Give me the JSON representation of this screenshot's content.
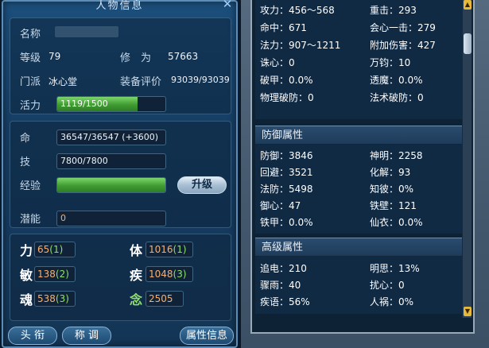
{
  "left": {
    "title": "人物信息",
    "name_label": "名称",
    "name_value": "",
    "level_label": "等级",
    "level_value": "79",
    "cultivation_label": "修　为",
    "cultivation_value": "57663",
    "faction_label": "门派",
    "faction_value": "冰心堂",
    "equip_label": "装备评价",
    "equip_value": "93039/93039",
    "vitality_label": "活力",
    "vitality_value": "1119/1500",
    "vitality_ratio": 0.746,
    "hp_label": "命",
    "hp_value": "36547/36547 (+3600)",
    "skill_label": "技",
    "skill_value": "7800/7800",
    "exp_label": "经验",
    "exp_ratio": 1.0,
    "upgrade_label": "升级",
    "potential_label": "潜能",
    "potential_value": "0",
    "attributes": [
      {
        "label": "力",
        "base": "65",
        "bonus": "(1)"
      },
      {
        "label": "体",
        "base": "1016",
        "bonus": "(1)"
      },
      {
        "label": "敏",
        "base": "138",
        "bonus": "(2)"
      },
      {
        "label": "疾",
        "base": "1048",
        "bonus": "(3)"
      },
      {
        "label": "魂",
        "base": "538",
        "bonus": "(3)"
      },
      {
        "label": "念",
        "base": "2505",
        "bonus": ""
      }
    ],
    "tabs": [
      "头 衔",
      "称 调",
      "属性信息"
    ]
  },
  "right": {
    "top_stats": [
      [
        "攻力：456～568",
        "重击：293"
      ],
      [
        "命中：671",
        "会心一击：279"
      ],
      [
        "法力：907～1211",
        "附加伤害：427"
      ],
      [
        "诛心：0",
        "万钧：10"
      ],
      [
        "破甲：0.0%",
        "透魔：0.0%"
      ],
      [
        "物理破防：0",
        "法术破防：0"
      ]
    ],
    "defense_title": "防御属性",
    "defense_stats": [
      [
        "防御：3846",
        "神明：2258"
      ],
      [
        "回避：3521",
        "化解：93"
      ],
      [
        "法防：5498",
        "知彼：0%"
      ],
      [
        "御心：47",
        "铁壁：121"
      ],
      [
        "铁甲：0.0%",
        "仙衣：0.0%"
      ]
    ],
    "advanced_title": "高级属性",
    "advanced_stats": [
      [
        "追电：210",
        "明思：13%"
      ],
      [
        "骤雨：40",
        "扰心：0"
      ],
      [
        "疾语：56%",
        "人祸：0%"
      ]
    ]
  },
  "colors": {
    "panel_blue": "#1c4f7c",
    "bar_green": "#3f9b32",
    "attr_orange": "#f3b073",
    "attr_bonus_green": "#8ee06a",
    "scroll_arrow_yellow": "#e8b838"
  }
}
